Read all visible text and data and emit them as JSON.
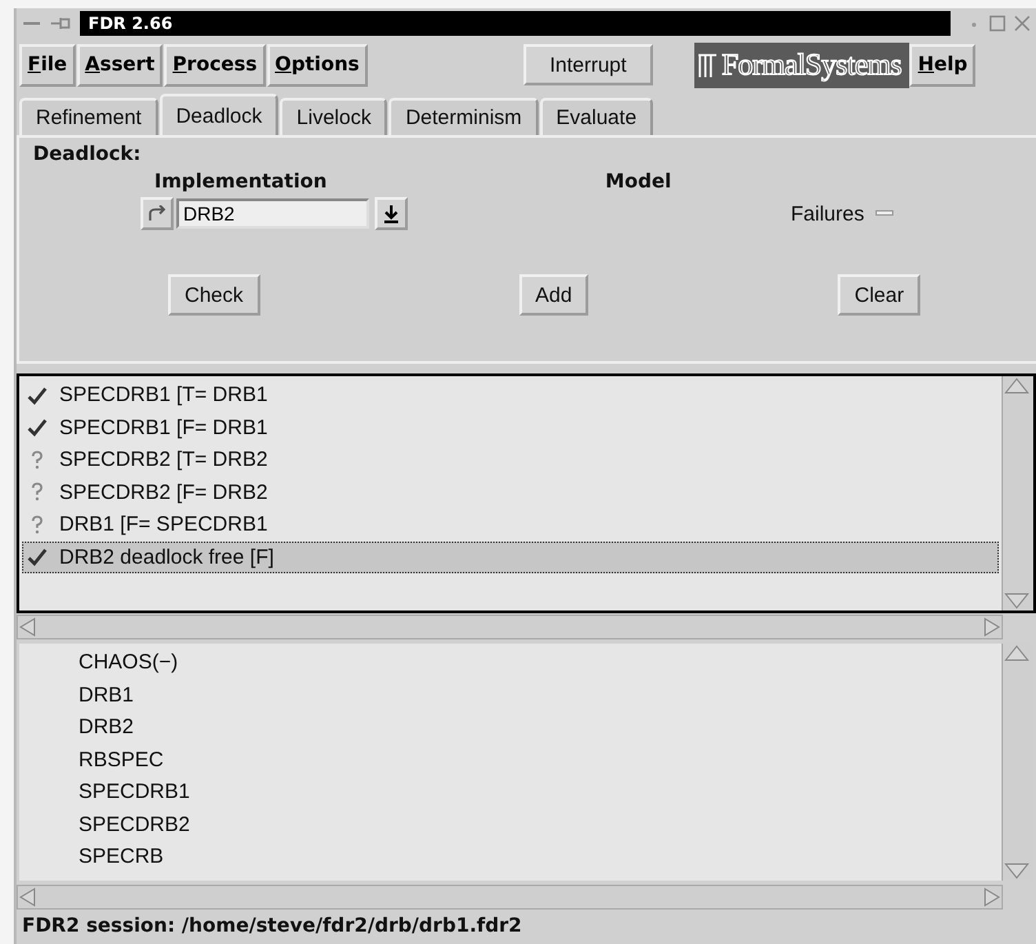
{
  "window": {
    "title": "FDR 2.66"
  },
  "menu": [
    {
      "label": "File"
    },
    {
      "label": "Assert"
    },
    {
      "label": "Process"
    },
    {
      "label": "Options"
    }
  ],
  "interrupt_button": "Interrupt",
  "logo": "FormalSystems",
  "help_menu": "Help",
  "tabs": [
    {
      "label": "Refinement",
      "selected": false
    },
    {
      "label": "Deadlock",
      "selected": true
    },
    {
      "label": "Livelock",
      "selected": false
    },
    {
      "label": "Determinism",
      "selected": false
    },
    {
      "label": "Evaluate",
      "selected": false
    }
  ],
  "panel": {
    "title": "Deadlock:",
    "implementation_label": "Implementation",
    "implementation_value": "DRB2",
    "model_label": "Model",
    "model_value": "Failures",
    "buttons": [
      "Check",
      "Add",
      "Clear"
    ]
  },
  "assertions": [
    {
      "kind": "passed",
      "text": "SPECDRB1 [T= DRB1",
      "selected": false
    },
    {
      "kind": "passed",
      "text": "SPECDRB1 [F= DRB1",
      "selected": false
    },
    {
      "kind": "unknown",
      "text": "SPECDRB2 [T= DRB2",
      "selected": false
    },
    {
      "kind": "unknown",
      "text": "SPECDRB2 [F= DRB2",
      "selected": false
    },
    {
      "kind": "unknown",
      "text": "DRB1 [F= SPECDRB1",
      "selected": false
    },
    {
      "kind": "passed",
      "text": "DRB2 deadlock free [F]",
      "selected": true
    }
  ],
  "processes": [
    "CHAOS(−)",
    "DRB1",
    "DRB2",
    "RBSPEC",
    "SPECDRB1",
    "SPECDRB2",
    "SPECRB"
  ],
  "status_bar": "FDR2 session: /home/steve/fdr2/drb/drb1.fdr2"
}
